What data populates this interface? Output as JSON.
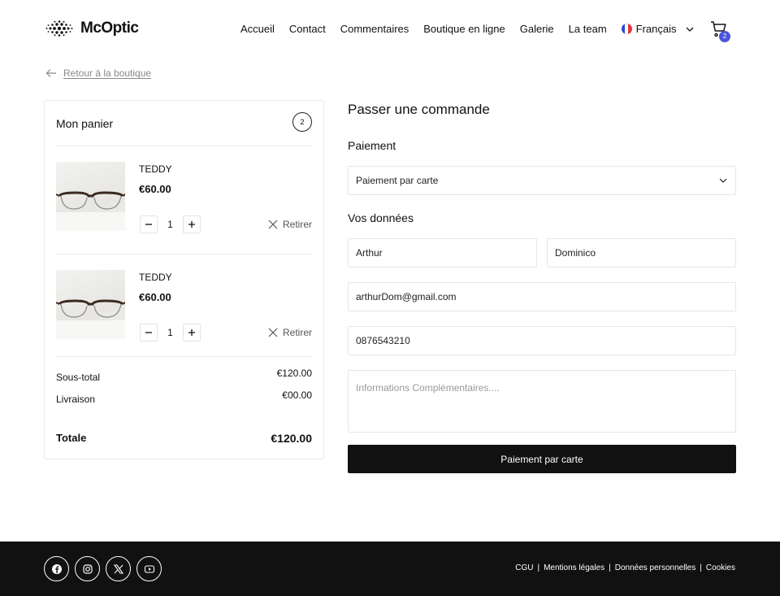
{
  "header": {
    "brand": "McOptic",
    "nav": [
      "Accueil",
      "Contact",
      "Commentaires",
      "Boutique en ligne",
      "Galerie",
      "La team"
    ],
    "language": "Français",
    "cart_count": "2"
  },
  "back_link": "Retour à la boutique",
  "cart": {
    "title": "Mon panier",
    "count": "2",
    "items": [
      {
        "name": "TEDDY",
        "price": "€60.00",
        "qty": "1",
        "remove": "Retirer"
      },
      {
        "name": "TEDDY",
        "price": "€60.00",
        "qty": "1",
        "remove": "Retirer"
      }
    ],
    "subtotal_label": "Sous-total",
    "subtotal": "€120.00",
    "shipping_label": "Livraison",
    "shipping": "€00.00",
    "total_label": "Totale",
    "total": "€120.00"
  },
  "order": {
    "title": "Passer une commande",
    "payment_label": "Paiement",
    "payment_selected": "Paiement par carte",
    "data_label": "Vos données",
    "first_name": "Arthur",
    "last_name": "Dominico",
    "email": "arthurDom@gmail.com",
    "phone": "0876543210",
    "notes_placeholder": "Informations Complémentaires....",
    "submit": "Paiement par carte"
  },
  "footer": {
    "social_icons": [
      "facebook-icon",
      "instagram-icon",
      "x-icon",
      "youtube-icon"
    ],
    "links": [
      "CGU",
      "Mentions légales",
      "Données personnelles",
      "Cookies"
    ]
  },
  "colors": {
    "accent": "#4c55d9",
    "dark": "#111111",
    "border": "#e8e8e8"
  }
}
